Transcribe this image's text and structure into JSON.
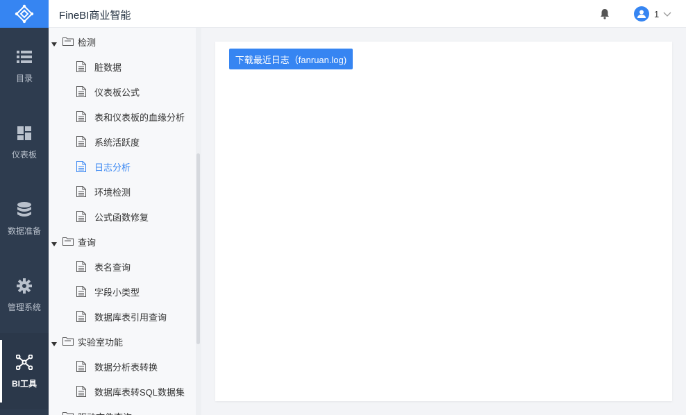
{
  "header": {
    "title": "FineBI商业智能",
    "user_name": "1"
  },
  "rail": {
    "items": [
      {
        "label": "目录",
        "icon": "list-icon"
      },
      {
        "label": "仪表板",
        "icon": "dashboard-icon"
      },
      {
        "label": "数据准备",
        "icon": "database-icon"
      },
      {
        "label": "管理系统",
        "icon": "gear-icon"
      },
      {
        "label": "BI工具",
        "icon": "bi-tools-icon",
        "active": true
      }
    ]
  },
  "tree": {
    "nodes": [
      {
        "type": "folder",
        "label": "检测"
      },
      {
        "type": "leaf",
        "label": "脏数据"
      },
      {
        "type": "leaf",
        "label": "仪表板公式"
      },
      {
        "type": "leaf",
        "label": "表和仪表板的血缘分析"
      },
      {
        "type": "leaf",
        "label": "系统活跃度"
      },
      {
        "type": "leaf",
        "label": "日志分析",
        "selected": true
      },
      {
        "type": "leaf",
        "label": "环境检测"
      },
      {
        "type": "leaf",
        "label": "公式函数修复"
      },
      {
        "type": "folder",
        "label": "查询"
      },
      {
        "type": "leaf",
        "label": "表名查询"
      },
      {
        "type": "leaf",
        "label": "字段小类型"
      },
      {
        "type": "leaf",
        "label": "数据库表引用查询"
      },
      {
        "type": "folder",
        "label": "实验室功能"
      },
      {
        "type": "leaf",
        "label": "数据分析表转换"
      },
      {
        "type": "leaf",
        "label": "数据库表转SQL数据集"
      },
      {
        "type": "folder",
        "label": "驱动文件查询"
      }
    ]
  },
  "main": {
    "download_label": "下载最近日志（fanruan.log)"
  },
  "colors": {
    "accent": "#3685f2",
    "rail_bg": "#2e3c4f"
  }
}
